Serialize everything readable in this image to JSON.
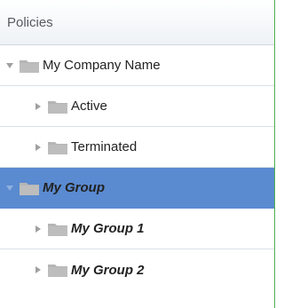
{
  "panel": {
    "title": "Policies"
  },
  "tree": {
    "root": {
      "label": "My Company Name",
      "expanded": true
    },
    "children": [
      {
        "label": "Active",
        "expanded": false
      },
      {
        "label": "Terminated",
        "expanded": false
      }
    ],
    "group": {
      "label": "My Group",
      "expanded": true,
      "selected": true
    },
    "group_children": [
      {
        "label": "My Group 1",
        "expanded": false
      },
      {
        "label": "My Group 2",
        "expanded": false
      }
    ]
  },
  "colors": {
    "selected_bg": "#5a8ad0",
    "folder_gray": "#b5b5b5",
    "accent_border": "#4caf50",
    "toggle_gray": "#a0a0a0"
  },
  "icons": {
    "collapsed": "triangle-right-icon",
    "expanded": "triangle-down-icon",
    "folder": "folder-icon"
  }
}
